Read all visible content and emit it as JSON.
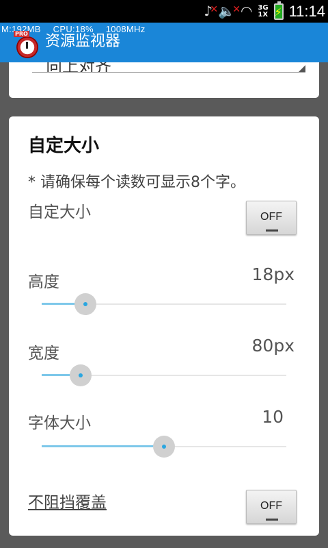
{
  "status_bar": {
    "icons": [
      "music-muted-icon",
      "volume-muted-icon",
      "wifi-icon",
      "network-3g-icon",
      "battery-charging-icon"
    ],
    "network_type": "3G",
    "network_sub": "1X",
    "time": "11:14"
  },
  "overlay": {
    "memory": "M:192MB",
    "cpu": "CPU:18%",
    "freq": "1008MHz"
  },
  "app_bar": {
    "title": "资源监视器",
    "badge": "PRO"
  },
  "top_card": {
    "spinner_text": "向上对齐"
  },
  "custom_size": {
    "title": "自定大小",
    "note": "* 请确保每个读数可显示8个字。",
    "toggle_label": "自定大小",
    "toggle_state": "OFF",
    "height": {
      "label": "高度",
      "value": "18px",
      "level": 0.18
    },
    "width": {
      "label": "宽度",
      "value": "80px",
      "level": 0.16
    },
    "font_size": {
      "label": "字体大小",
      "value": "10",
      "level": 0.5
    },
    "no_block_label": "不阻挡覆盖",
    "no_block_state": "OFF"
  },
  "colors": {
    "accent": "#1a86d8",
    "slider_fill": "#7ec8ea",
    "slider_dot": "#2aa6e0"
  }
}
